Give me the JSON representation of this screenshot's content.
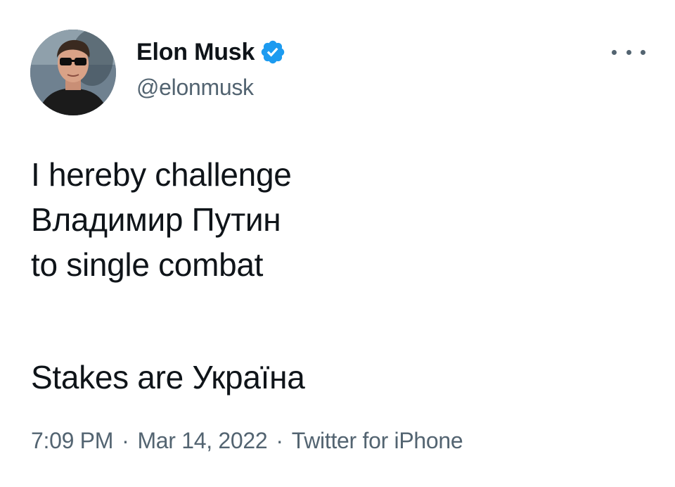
{
  "author": {
    "display_name": "Elon Musk",
    "handle": "@elonmusk",
    "verified": true,
    "avatar_icon": "profile-photo",
    "verified_icon": "verified-badge-icon"
  },
  "actions": {
    "more_icon": "more-horizontal-icon"
  },
  "tweet": {
    "lines": [
      "I hereby challenge",
      "Владимир Путин",
      "to single combat"
    ],
    "closing_line": "Stakes are Україна"
  },
  "meta": {
    "time": "7:09 PM",
    "separator": "·",
    "date": "Mar 14, 2022",
    "source": "Twitter for iPhone"
  },
  "colors": {
    "text_primary": "#0f1419",
    "text_secondary": "#536471",
    "verified_blue": "#1d9bf0",
    "background": "#ffffff"
  }
}
